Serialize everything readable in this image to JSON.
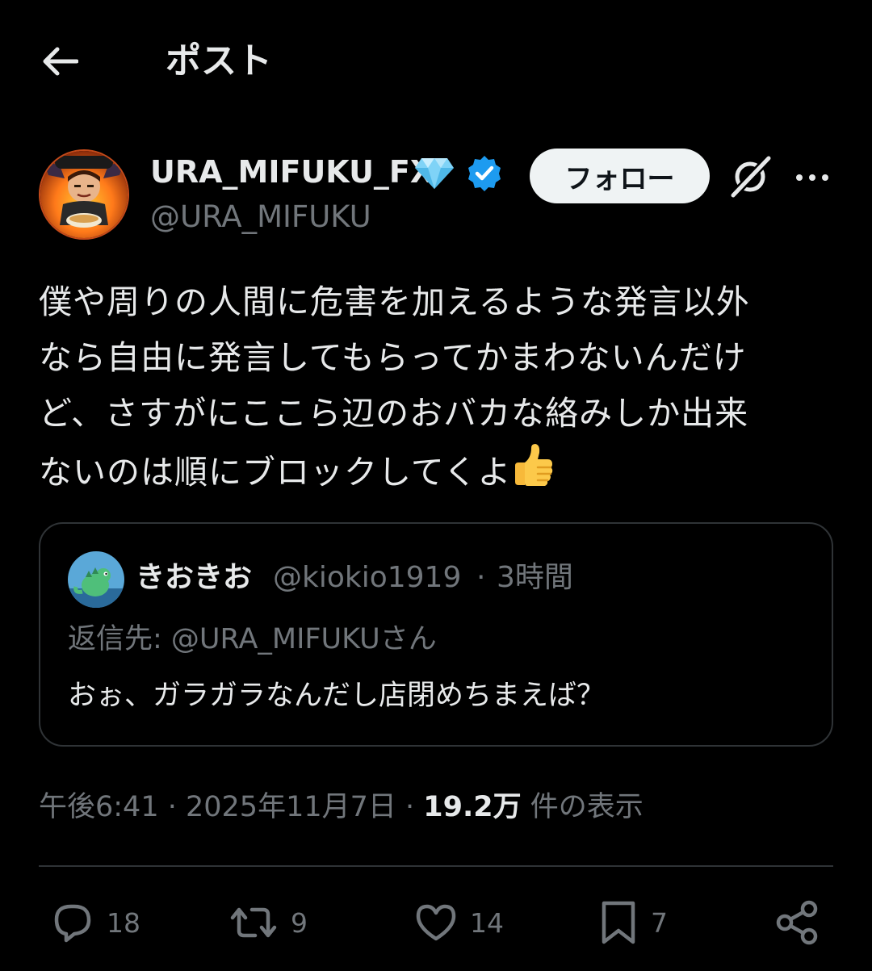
{
  "header": {
    "title": "ポスト"
  },
  "author": {
    "name": "URA_MIFUKU_FX",
    "handle": "@URA_MIFUKU",
    "follow_label": "フォロー"
  },
  "post": {
    "text": "僕や周りの人間に危害を加えるような発言以外\nなら自由に発言してもらってかまわないんだけ\nど、さすがにここら辺のおバカな絡みしか出来\nないのは順にブロックしてくよ"
  },
  "quote": {
    "name": "きおきお",
    "handle": "@kiokio1919",
    "dot": "·",
    "time": "3時間",
    "reply_prefix": "返信先: ",
    "reply_handle": "@URA_MIFUKU",
    "reply_suffix": "さん",
    "text": "おぉ、ガラガラなんだし店閉めちまえば？"
  },
  "meta": {
    "time": "午後6:41",
    "date": "2025年11月7日",
    "views_count": "19.2万",
    "views_label": "件の表示"
  },
  "actions": {
    "replies": "18",
    "reposts": "9",
    "likes": "14",
    "bookmarks": "7"
  },
  "colors": {
    "background": "#000000",
    "text": "#e7e9ea",
    "secondary": "#71767b",
    "border": "#2f3336",
    "verified": "#1d9bf0"
  },
  "icons": {
    "back": "arrow-left-icon",
    "verified": "verified-badge-icon",
    "gem": "diamond-icon",
    "grok": "grok-icon",
    "more": "more-icon",
    "reply": "reply-icon",
    "repost": "repost-icon",
    "like": "heart-icon",
    "bookmark": "bookmark-icon",
    "share": "share-icon"
  }
}
